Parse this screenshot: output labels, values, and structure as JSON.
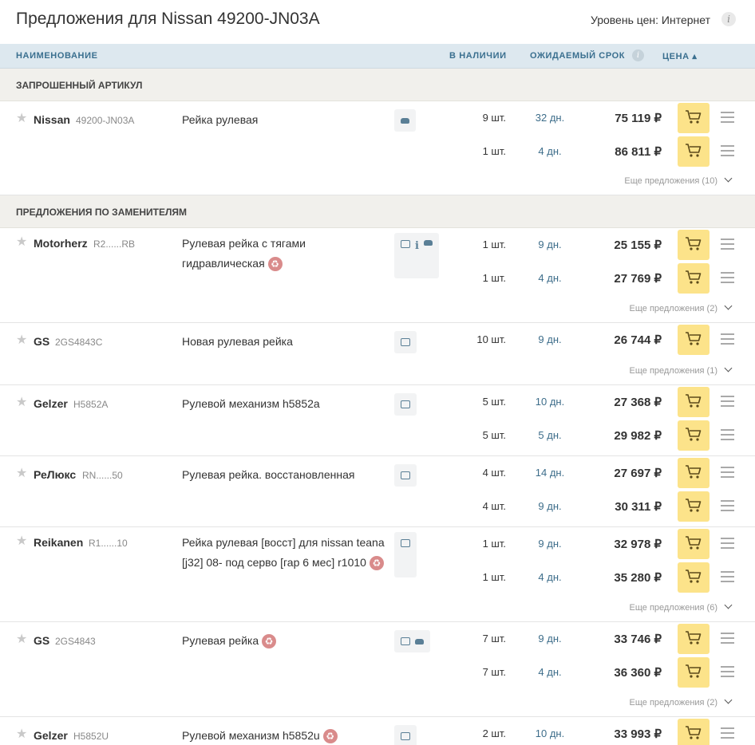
{
  "header": {
    "title": "Предложения для  Nissan 49200-JN03A",
    "price_level": "Уровень цен: Интернет",
    "info_icon": "i"
  },
  "columns": {
    "name": "НАИМЕНОВАНИЕ",
    "stock": "В НАЛИЧИИ",
    "term": "ОЖИДАЕМЫЙ СРОК",
    "price": "ЦЕНА ▴"
  },
  "sections": {
    "requested": "ЗАПРОШЕННЫЙ АРТИКУЛ",
    "substitutes": "ПРЕДЛОЖЕНИЯ ПО ЗАМЕНИТЕЛЯМ"
  },
  "icons": {
    "star": "star-icon",
    "cart": "cart-icon",
    "menu": "menu-icon",
    "recycle": "recycle-icon",
    "chip": "part-icon",
    "car": "car-icon",
    "info": "info-icon"
  },
  "products": [
    {
      "brand": "Nissan",
      "code": "49200-JN03A",
      "desc": "Рейка рулевая",
      "recycled": false,
      "icons": [
        "car"
      ],
      "offers": [
        {
          "qty": "9 шт.",
          "days": "32 дн.",
          "price": "75 119 ₽"
        },
        {
          "qty": "1 шт.",
          "days": "4 дн.",
          "price": "86 811 ₽"
        }
      ],
      "more": "Еще предложения (10)"
    },
    {
      "brand": "Motorherz",
      "code": "R2......RB",
      "desc": "Рулевая рейка с тягами гидравлическая",
      "recycled": true,
      "icons": [
        "chip",
        "info",
        "car"
      ],
      "offers": [
        {
          "qty": "1 шт.",
          "days": "9 дн.",
          "price": "25 155 ₽"
        },
        {
          "qty": "1 шт.",
          "days": "4 дн.",
          "price": "27 769 ₽"
        }
      ],
      "more": "Еще предложения (2)"
    },
    {
      "brand": "GS",
      "code": "2GS4843C",
      "desc": "Новая рулевая рейка",
      "recycled": false,
      "icons": [
        "chip"
      ],
      "offers": [
        {
          "qty": "10 шт.",
          "days": "9 дн.",
          "price": "26 744 ₽"
        }
      ],
      "more": "Еще предложения (1)"
    },
    {
      "brand": "Gelzer",
      "code": "H5852A",
      "desc": "Рулевой механизм h5852a",
      "recycled": false,
      "icons": [
        "chip"
      ],
      "offers": [
        {
          "qty": "5 шт.",
          "days": "10 дн.",
          "price": "27 368 ₽"
        },
        {
          "qty": "5 шт.",
          "days": "5 дн.",
          "price": "29 982 ₽"
        }
      ],
      "more": ""
    },
    {
      "brand": "РеЛюкс",
      "code": "RN......50",
      "desc": "Рулевая рейка. восстановленная",
      "recycled": false,
      "icons": [
        "chip"
      ],
      "offers": [
        {
          "qty": "4 шт.",
          "days": "14 дн.",
          "price": "27 697 ₽"
        },
        {
          "qty": "4 шт.",
          "days": "9 дн.",
          "price": "30 311 ₽"
        }
      ],
      "more": ""
    },
    {
      "brand": "Reikanen",
      "code": "R1......10",
      "desc": "Рейка рулевая [восст] для nissan teana [j32] 08- под серво [гар 6 мес] r1010",
      "recycled": true,
      "icons": [
        "chip"
      ],
      "offers": [
        {
          "qty": "1 шт.",
          "days": "9 дн.",
          "price": "32 978 ₽"
        },
        {
          "qty": "1 шт.",
          "days": "4 дн.",
          "price": "35 280 ₽"
        }
      ],
      "more": "Еще предложения (6)"
    },
    {
      "brand": "GS",
      "code": "2GS4843",
      "desc": "Рулевая рейка",
      "recycled": true,
      "icons": [
        "chip",
        "car"
      ],
      "offers": [
        {
          "qty": "7 шт.",
          "days": "9 дн.",
          "price": "33 746 ₽"
        },
        {
          "qty": "7 шт.",
          "days": "4 дн.",
          "price": "36 360 ₽"
        }
      ],
      "more": "Еще предложения (2)"
    },
    {
      "brand": "Gelzer",
      "code": "H5852U",
      "desc": "Рулевой механизм h5852u",
      "recycled": true,
      "icons": [
        "chip"
      ],
      "offers": [
        {
          "qty": "2 шт.",
          "days": "10 дн.",
          "price": "33 993 ₽"
        }
      ],
      "more": ""
    }
  ]
}
